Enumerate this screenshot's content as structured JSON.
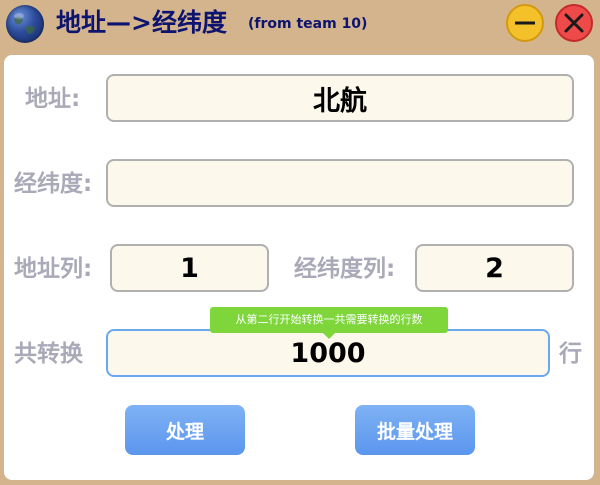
{
  "window": {
    "title": "地址—>经纬度",
    "subtitle": "(from team 10)",
    "minimize_icon": "minus-icon",
    "close_icon": "x-icon",
    "colors": {
      "titlebar": "#d4b48c",
      "title_text": "#0d1470",
      "minimize": "#f5c12a",
      "close": "#ef4a4a"
    }
  },
  "form": {
    "address_label": "地址:",
    "address_value": "北航",
    "coords_label": "经纬度:",
    "coords_value": "",
    "address_col_label": "地址列:",
    "address_col_value": "1",
    "coords_col_label": "经纬度列:",
    "coords_col_value": "2",
    "total_label": "共转换",
    "total_value": "1000",
    "total_unit": "行",
    "tooltip": "从第二行开始转换一共需要转换的行数"
  },
  "actions": {
    "process_label": "处理",
    "batch_label": "批量处理",
    "button_color": "#6aa3f0"
  }
}
